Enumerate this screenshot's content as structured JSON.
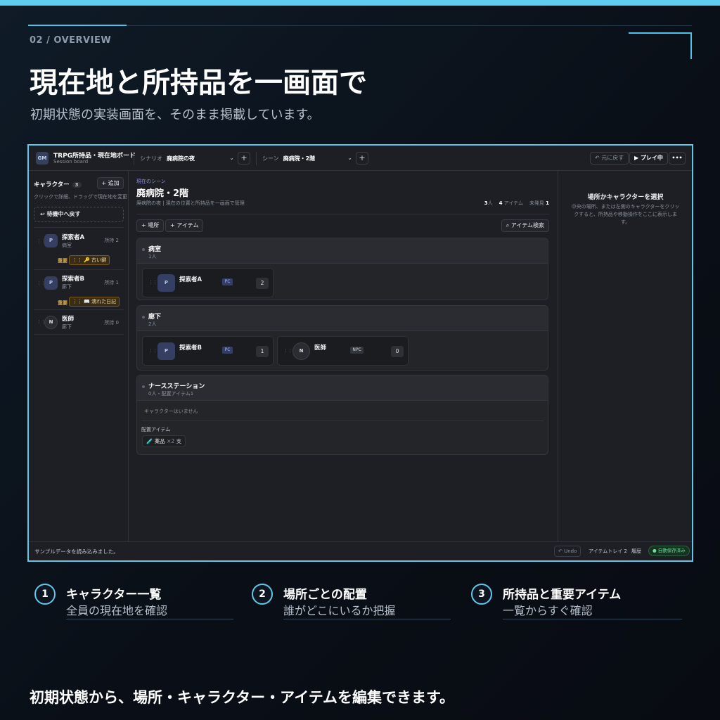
{
  "kicker": "02 / OVERVIEW",
  "hero_title": "現在地と所持品を一画面で",
  "hero_sub": "初期状態の実装画面を、そのまま掲載しています。",
  "app": {
    "gm": "GM",
    "title": "TRPG所持品・現在地ボード",
    "subtitle": "Session board",
    "scenario_label": "シナリオ",
    "scenario_value": "廃病院の夜",
    "scene_label": "シーン",
    "scene_value": "廃病院・2階",
    "undo": "↶ 元に戻す",
    "play": "▶ プレイ中",
    "more": "•••",
    "left": {
      "title": "キャラクター",
      "count": "3",
      "add": "+ 追加",
      "hint": "クリックで詳細、ドラッグで現在地を変更",
      "standby": "待機中へ戻す",
      "chars": [
        {
          "avatar": "P",
          "name": "探索者A",
          "loc": "病室",
          "count": "所持 2",
          "imp": "重要",
          "item": "⋮⋮ 🔑 古い鍵"
        },
        {
          "avatar": "P",
          "name": "探索者B",
          "loc": "廊下",
          "count": "所持 1",
          "imp": "重要",
          "item": "⋮⋮ 📖 濡れた日記"
        },
        {
          "avatar": "N",
          "name": "医師",
          "loc": "廊下",
          "count": "所持 0"
        }
      ]
    },
    "mid": {
      "kicker": "現在のシーン",
      "title": "廃病院・2階",
      "sub": "廃病院の夜 | 現在の位置と所持品を一画面で管理",
      "stats": {
        "people": "3",
        "people_unit": "人",
        "items": "4",
        "items_unit": "アイテム",
        "undiscovered_label": "未発見",
        "undiscovered": "1"
      },
      "add_place": "+ 場所",
      "add_item": "+ アイテム",
      "search": "⌕ アイテム検索",
      "locations": [
        {
          "name": "病室",
          "count": "1人",
          "cards": [
            {
              "avatar": "P",
              "name": "探索者A",
              "tag": "PC",
              "num": "2"
            }
          ]
        },
        {
          "name": "廊下",
          "count": "2人",
          "cards": [
            {
              "avatar": "P",
              "name": "探索者B",
              "tag": "PC",
              "num": "1"
            },
            {
              "avatar": "N",
              "name": "医師",
              "tag": "NPC",
              "num": "0"
            }
          ]
        },
        {
          "name": "ナースステーション",
          "count": "0人・配置アイテム1",
          "empty": "キャラクターはいません",
          "placed_label": "配置アイテム",
          "item": "🧪 薬品",
          "item_qty": "×2",
          "item_suffix": "支"
        }
      ]
    },
    "right": {
      "title": "場所かキャラクターを選択",
      "desc": "中央の場所、または左側のキャラクターをクリックすると、所持品や移動操作をここに表示します。"
    },
    "status": {
      "msg": "サンプルデータを読み込みました。",
      "undo": "↶ Undo",
      "tray": "アイテムトレイ 2",
      "history": "履歴",
      "saved": "● 自動保存済み"
    }
  },
  "features": [
    {
      "num": "1",
      "title": "キャラクター一覧",
      "sub": "全員の現在地を確認"
    },
    {
      "num": "2",
      "title": "場所ごとの配置",
      "sub": "誰がどこにいるか把握"
    },
    {
      "num": "3",
      "title": "所持品と重要アイテム",
      "sub": "一覧からすぐ確認"
    }
  ],
  "footer": "初期状態から、場所・キャラクター・アイテムを編集できます。",
  "colors": {
    "accent": "#5fc8ea",
    "panel": "#1d1f24",
    "important": "#e0a940",
    "pc_tag": "#333e68",
    "saved": "#6fdc98"
  }
}
